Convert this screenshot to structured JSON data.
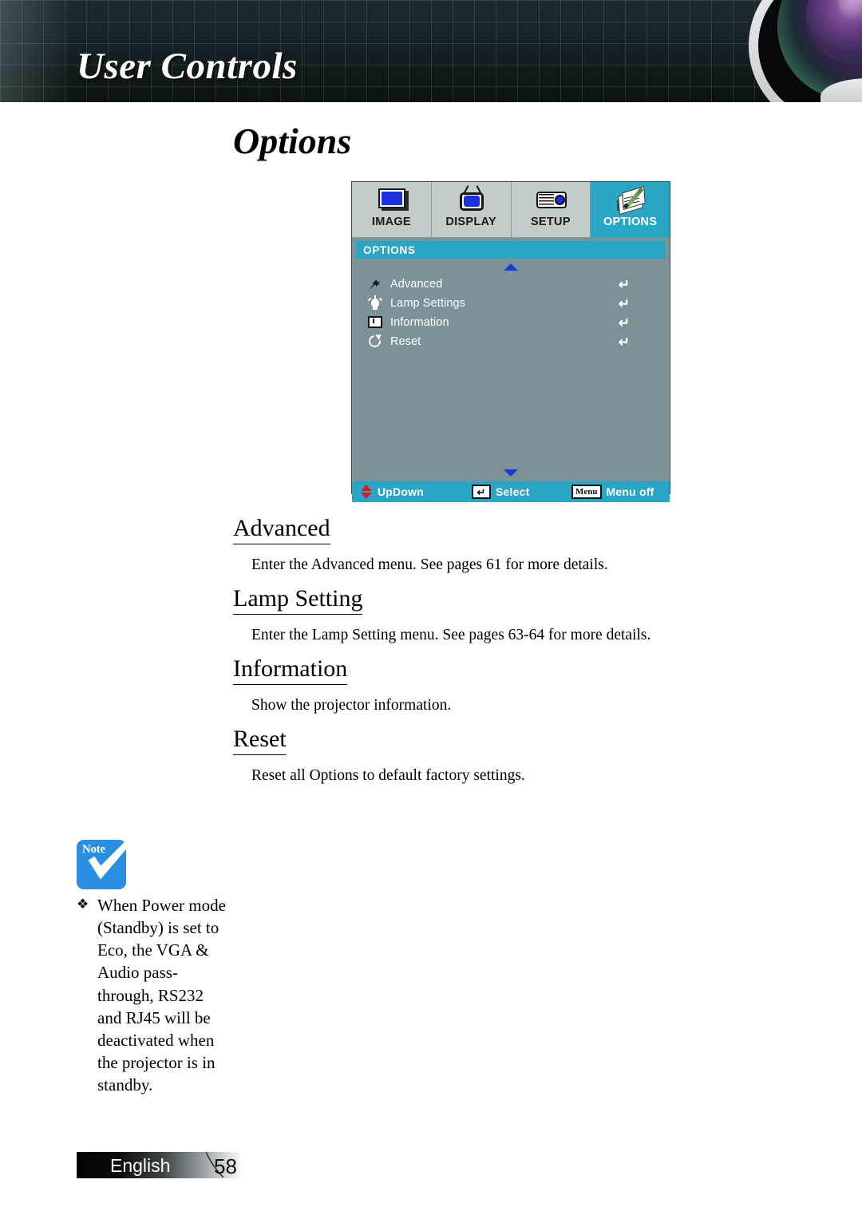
{
  "header": {
    "title": "User Controls",
    "lens_image": "projector-lens-photo"
  },
  "page": {
    "title": "Options"
  },
  "osd": {
    "tabs": [
      {
        "label": "IMAGE",
        "icon": "monitor-icon",
        "active": false
      },
      {
        "label": "DISPLAY",
        "icon": "tv-icon",
        "active": false
      },
      {
        "label": "SETUP",
        "icon": "projector-icon",
        "active": false
      },
      {
        "label": "OPTIONS",
        "icon": "notepad-pen-icon",
        "active": true
      }
    ],
    "title_bar": "OPTIONS",
    "scroll_up": "scroll-up-arrow",
    "scroll_down": "scroll-down-arrow",
    "items": [
      {
        "label": "Advanced",
        "icon": "wand-star-icon",
        "action": "↵"
      },
      {
        "label": "Lamp Settings",
        "icon": "lightbulb-icon",
        "action": "↵"
      },
      {
        "label": "Information",
        "icon": "info-icon",
        "action": "↵"
      },
      {
        "label": "Reset",
        "icon": "reset-circular-arrow-icon",
        "action": "↵"
      }
    ],
    "footer": {
      "updown_label": "UpDown",
      "select_key": "↵",
      "select_label": "Select",
      "menu_key": "Menu",
      "menu_label": "Menu off"
    },
    "colors": {
      "body": "#7b9396",
      "accent": "#29a5c6",
      "tab_inactive": "#c2cccb",
      "arrow_blue": "#1f35d8",
      "arrow_red": "#e01b1b"
    }
  },
  "sections": [
    {
      "heading": "Advanced",
      "body": "Enter the Advanced menu. See pages 61 for more details."
    },
    {
      "heading": "Lamp Setting",
      "body": "Enter the Lamp Setting menu. See pages 63-64 for more details."
    },
    {
      "heading": "Information",
      "body": "Show the projector information."
    },
    {
      "heading": "Reset",
      "body": "Reset all Options to default factory settings."
    }
  ],
  "note": {
    "badge_label": "Note",
    "badge_icon": "checkmark-icon",
    "bullet": "❖",
    "text": "When Power mode (Standby) is set to Eco, the VGA & Audio pass-through, RS232 and RJ45 will be deactivated when the projector is in standby."
  },
  "footer": {
    "language": "English",
    "page_number": "58"
  }
}
